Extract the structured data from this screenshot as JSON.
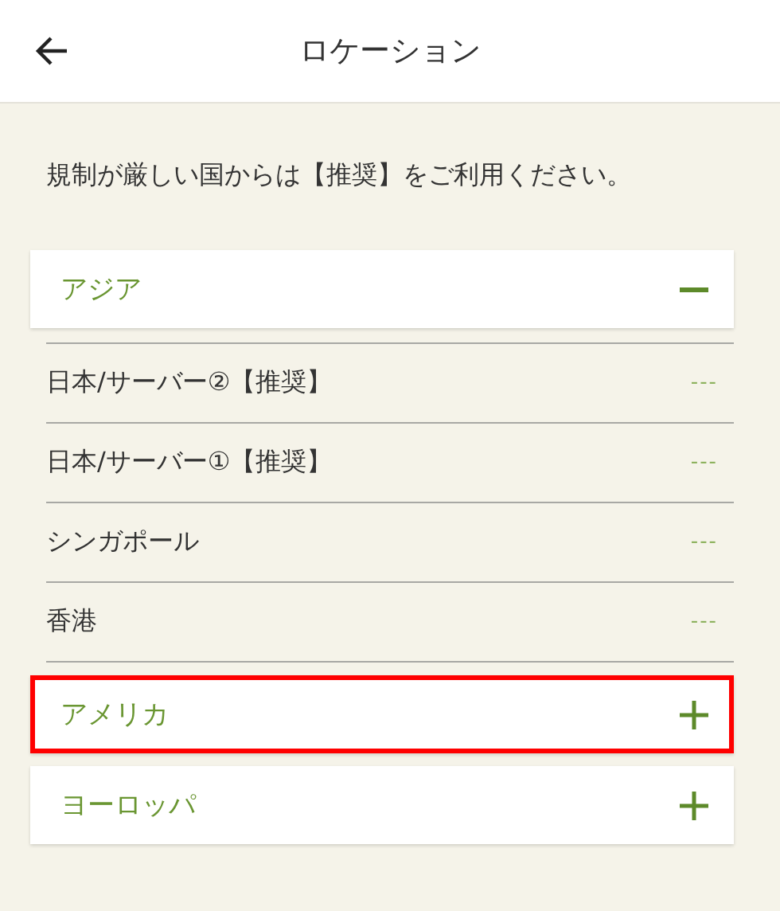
{
  "header": {
    "title": "ロケーション"
  },
  "notice": "規制が厳しい国からは【推奨】をご利用ください。",
  "regions": [
    {
      "name": "アジア",
      "expanded": true,
      "highlighted": false,
      "servers": [
        {
          "name": "日本/サーバー②【推奨】",
          "ping": "---"
        },
        {
          "name": "日本/サーバー①【推奨】",
          "ping": "---"
        },
        {
          "name": "シンガポール",
          "ping": "---"
        },
        {
          "name": "香港",
          "ping": "---"
        }
      ]
    },
    {
      "name": "アメリカ",
      "expanded": false,
      "highlighted": true
    },
    {
      "name": "ヨーロッパ",
      "expanded": false,
      "highlighted": false
    }
  ]
}
